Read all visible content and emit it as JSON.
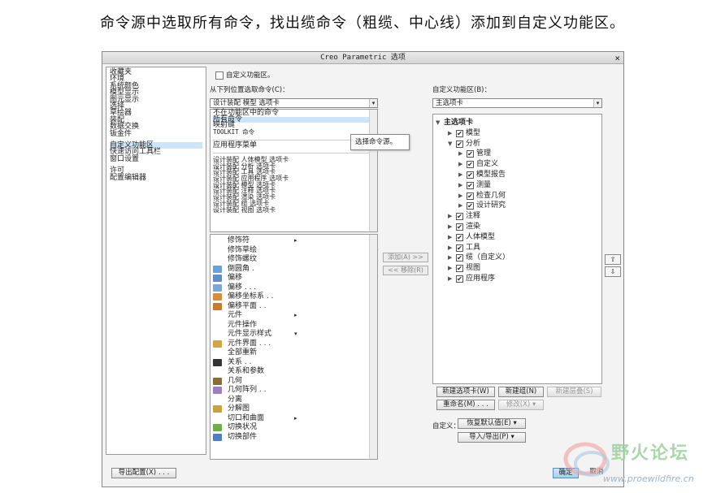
{
  "caption": "命令源中选取所有命令，找出缆命令（粗缆、中心线）添加到自定义功能区。",
  "dialog": {
    "title": "Creo Parametric 选项",
    "close": "×",
    "left_nav": {
      "group1": [
        "收藏夹",
        "环境",
        "系统颜色",
        "模型显示",
        "图元显示",
        "选择",
        "草绘器",
        "装配",
        "数据交换",
        "钣金件"
      ],
      "group2": [
        "自定义功能区",
        "快速访问工具栏",
        "窗口设置"
      ],
      "group3": [
        "许可",
        "配置编辑器"
      ],
      "selected": "自定义功能区"
    },
    "show_label": "自定义功能区。",
    "choose_from_label": "从下列位置选取命令(C)：",
    "choose_from_value": "设计装配 模型 选项卡",
    "command_sources": [
      "不在功能区中的命令",
      "所有命令",
      "映射键",
      "TOOLKIT 命令"
    ],
    "selected_source": "所有命令",
    "app_menu": "应用程序菜单",
    "design_tabs": [
      "设计装配  人体模型 选项卡",
      "设计装配  分析 选项卡",
      "设计装配  工具 选项卡",
      "设计装配  应用程序 选项卡",
      "设计装配  模型 选项卡",
      "设计装配  注释 选项卡",
      "设计装配  渲染 选项卡",
      "设计装配  缆 选项卡",
      "设计装配  视图 选项卡"
    ],
    "tooltip": "选择命令源。",
    "commands": [
      {
        "label": "修饰符",
        "sub": "▸",
        "icon": ""
      },
      {
        "label": "修饰草绘",
        "sub": "",
        "icon": ""
      },
      {
        "label": "修饰螺纹",
        "sub": "",
        "icon": ""
      },
      {
        "label": "倒圆角 .",
        "sub": "",
        "icon": "#6a9fd8"
      },
      {
        "label": "偏移",
        "sub": "",
        "icon": "#5f8fc4"
      },
      {
        "label": "偏移 . . .",
        "sub": "",
        "icon": "#7aa7d4"
      },
      {
        "label": "偏移坐标系 . .",
        "sub": "",
        "icon": "#d98c3a"
      },
      {
        "label": "偏移平面 . .",
        "sub": "",
        "icon": "#c97a2e"
      },
      {
        "label": "元件",
        "sub": "▸",
        "icon": ""
      },
      {
        "label": "元件操作",
        "sub": "",
        "icon": ""
      },
      {
        "label": "元件显示样式",
        "sub": "▾",
        "icon": ""
      },
      {
        "label": "元件界面 . . .",
        "sub": "",
        "icon": "#d4a640"
      },
      {
        "label": "全部重新",
        "sub": "",
        "icon": ""
      },
      {
        "label": "关系 . .",
        "sub": "",
        "icon": "#333"
      },
      {
        "label": "关系和参数",
        "sub": "",
        "icon": ""
      },
      {
        "label": "几何",
        "sub": "",
        "icon": "#8a6b3a"
      },
      {
        "label": "几何阵列 . .",
        "sub": "",
        "icon": "#9b7fc0"
      },
      {
        "label": "分离",
        "sub": "",
        "icon": ""
      },
      {
        "label": "分解图",
        "sub": "",
        "icon": "#c9a23a"
      },
      {
        "label": "切口和曲面",
        "sub": "▸",
        "icon": ""
      },
      {
        "label": "切换状况",
        "sub": "",
        "icon": "#6fae4e"
      },
      {
        "label": "切换部件",
        "sub": "",
        "icon": "#4f7fbf"
      }
    ],
    "add_button": "添加(A) >>",
    "remove_button": "<< 移除(R)",
    "customize_label": "自定义功能区(B)：",
    "customize_value": "主选项卡",
    "tree": {
      "root": "主选项卡",
      "items": [
        {
          "label": "模型",
          "level": 1,
          "expanded": false
        },
        {
          "label": "分析",
          "level": 1,
          "expanded": true
        },
        {
          "label": "管理",
          "level": 2,
          "expanded": false
        },
        {
          "label": "自定义",
          "level": 2,
          "expanded": false
        },
        {
          "label": "模型报告",
          "level": 2,
          "expanded": false
        },
        {
          "label": "测量",
          "level": 2,
          "expanded": false
        },
        {
          "label": "检查几何",
          "level": 2,
          "expanded": false
        },
        {
          "label": "设计研究",
          "level": 2,
          "expanded": false
        },
        {
          "label": "注释",
          "level": 1,
          "expanded": false
        },
        {
          "label": "渲染",
          "level": 1,
          "expanded": false
        },
        {
          "label": "人体模型",
          "level": 1,
          "expanded": false
        },
        {
          "label": "工具",
          "level": 1,
          "expanded": false
        },
        {
          "label": "缆（自定义）",
          "level": 1,
          "expanded": false
        },
        {
          "label": "视图",
          "level": 1,
          "expanded": false
        },
        {
          "label": "应用程序",
          "level": 1,
          "expanded": false
        }
      ]
    },
    "new_tab": "新建选项卡(W)",
    "new_group": "新建组(N)",
    "new_cascade": "新建层叠(S)",
    "rename": "重命名(M) . . .",
    "modify": "修改(X)",
    "customize_small": "自定义：",
    "reset_defaults": "恢复默认值(E)",
    "import_export": "导入/导出(P)",
    "export_config": "导出配置(X) . . .",
    "ok": "确定",
    "cancel": "取消"
  },
  "watermark": {
    "text": "野火论坛",
    "url": "www.proewildfire.cn"
  }
}
